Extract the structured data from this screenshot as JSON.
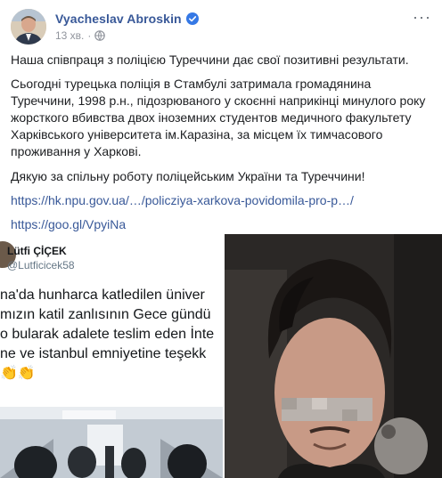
{
  "post": {
    "author": "Vyacheslav Abroskin",
    "timestamp": "13 хв.",
    "separator": "·",
    "paragraph_1": "Наша співпраця з поліцією Туреччини дає свої позитивні результати.",
    "paragraph_2_lines": [
      "Сьогодні турецька поліція в Стамбулі затримала громадянина",
      "Туреччини, 1998 р.н., підозрюваного у скоєнні наприкінці минулого року",
      "жорсткого вбивства двох іноземних студентов медичного факультету",
      "Харківського університета ім.Каразіна, за місцем їх тимчасового",
      "проживання у Харкові."
    ],
    "paragraph_3": "Дякую за спільну роботу поліцейським України та Туреччини!",
    "link_1": "https://hk.npu.gov.ua/…/policziya-xarkova-povidomila-pro-p…/",
    "link_2": "https://goo.gl/VpyiNa",
    "more_label": "···"
  },
  "tweet": {
    "name": "Lütfi ÇİÇEK",
    "handle": "@Lutficicek58",
    "lines": [
      "na'da hunharca katledilen üniver",
      "mızın katil zanlısının Gece gündü",
      "o bularak adalete teslim eden İnte",
      "ne ve istanbul emniyetine teşekk",
      "👏👏"
    ]
  },
  "colors": {
    "link": "#385898",
    "meta": "#90949c",
    "verified": "#3578e5"
  },
  "icons": [
    "verified-badge-icon",
    "globe-icon",
    "more-options-icon"
  ]
}
